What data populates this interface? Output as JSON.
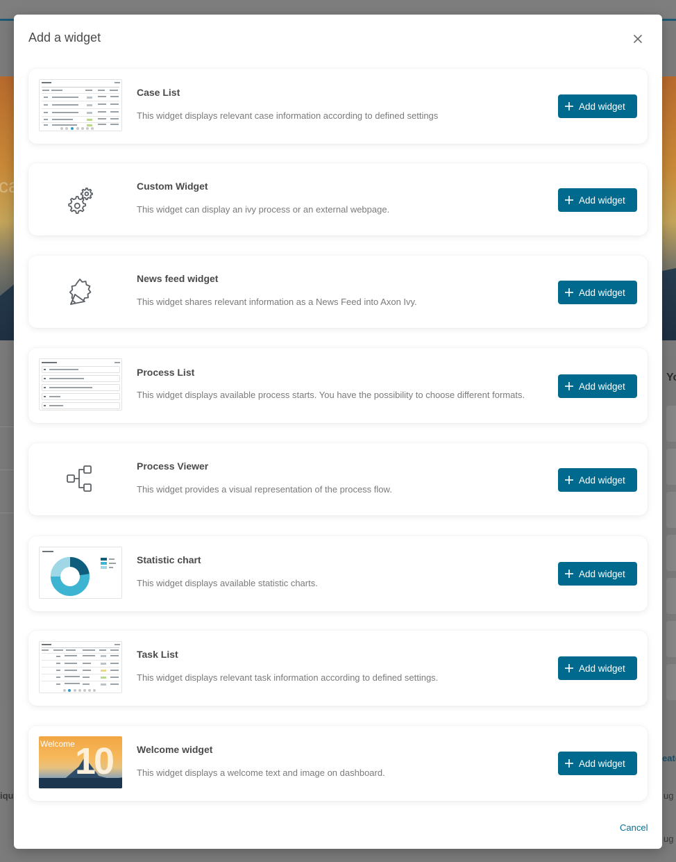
{
  "modal": {
    "title": "Add a widget",
    "cancel_label": "Cancel"
  },
  "widgets": [
    {
      "title": "Case List",
      "description": "This widget displays relevant case information according to defined settings",
      "button_label": "Add widget",
      "preview": "case-list-table"
    },
    {
      "title": "Custom Widget",
      "description": "This widget can display an ivy process or an external webpage.",
      "button_label": "Add widget",
      "icon": "gears-icon"
    },
    {
      "title": "News feed widget",
      "description": "This widget shares relevant information as a News Feed into Axon Ivy.",
      "button_label": "Add widget",
      "icon": "megaphone-icon"
    },
    {
      "title": "Process List",
      "description": "This widget displays available process starts. You have the possibility to choose different formats.",
      "button_label": "Add widget",
      "preview": "process-list"
    },
    {
      "title": "Process Viewer",
      "description": "This widget provides a visual representation of the process flow.",
      "button_label": "Add widget",
      "icon": "process-flow-icon"
    },
    {
      "title": "Statistic chart",
      "description": "This widget displays available statistic charts.",
      "button_label": "Add widget",
      "preview": "donut-chart"
    },
    {
      "title": "Task List",
      "description": "This widget displays relevant task information according to defined settings.",
      "button_label": "Add widget",
      "preview": "task-list-table"
    },
    {
      "title": "Welcome widget",
      "description": "This widget displays a welcome text and image on dashboard.",
      "button_label": "Add widget",
      "preview": "welcome-image",
      "preview_text": "Welcome",
      "preview_number": "10"
    }
  ],
  "background": {
    "banner_word": "ca",
    "side_heading": "Yo",
    "left_fragment": "ique",
    "right_fragment_1": "eate",
    "right_fragment_2": "ug",
    "right_fragment_3": "ug"
  },
  "colors": {
    "primary": "#006a8e",
    "link": "#0b6f93",
    "title_text": "#4a4a4a",
    "desc_text": "#7a7a7a"
  }
}
